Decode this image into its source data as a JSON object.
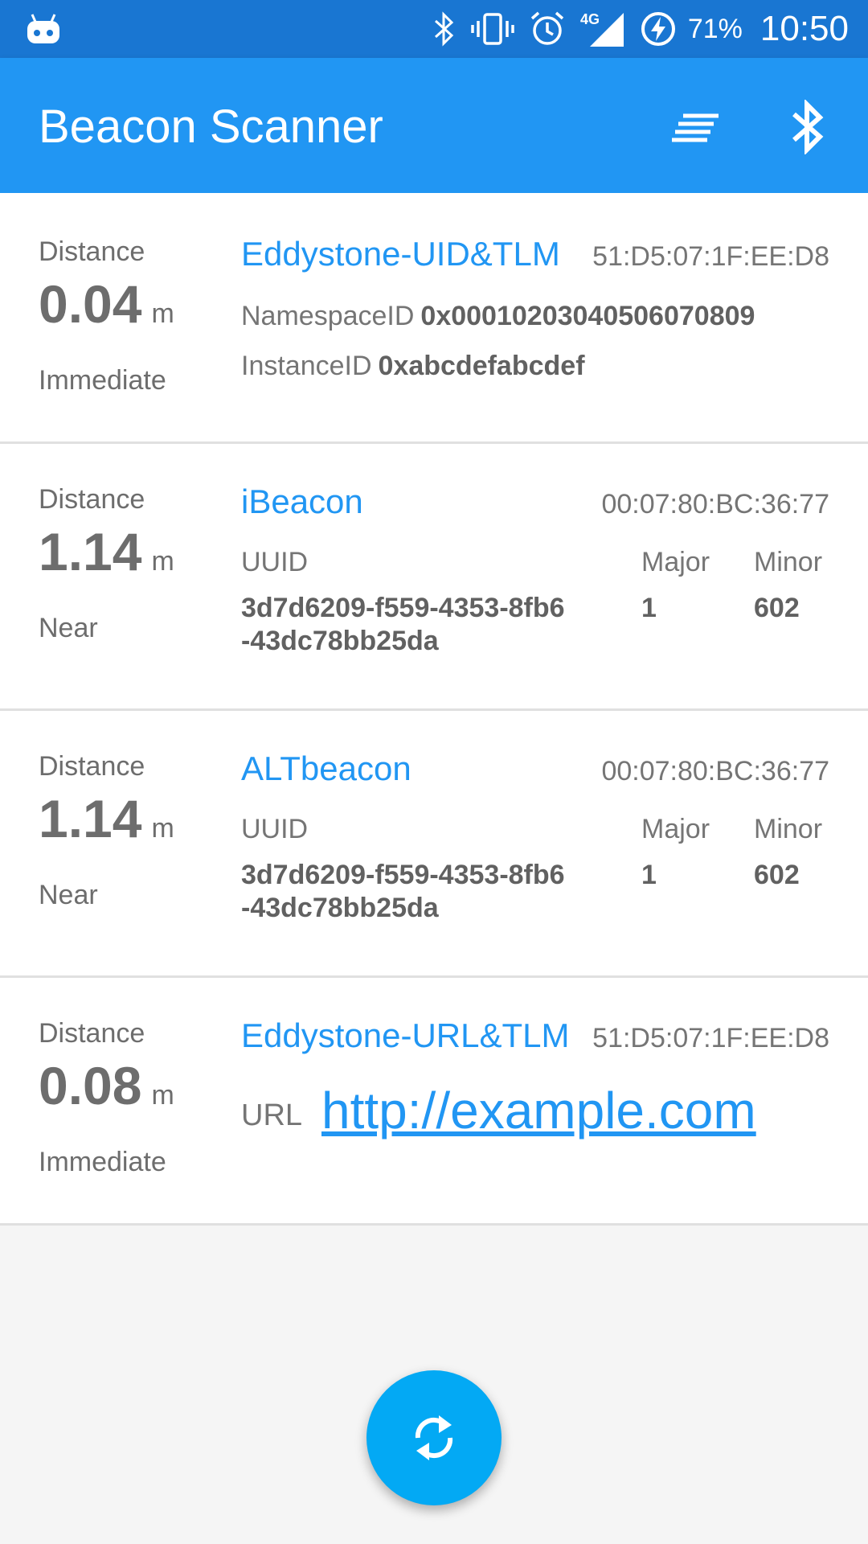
{
  "status_bar": {
    "battery": "71%",
    "time": "10:50",
    "network": "4G",
    "icons": [
      "android-robot-icon",
      "bluetooth-icon",
      "vibrate-icon",
      "alarm-icon",
      "signal-icon",
      "battery-charging-icon"
    ]
  },
  "app_bar": {
    "title": "Beacon Scanner",
    "actions": [
      "sort-icon",
      "bluetooth-icon"
    ]
  },
  "beacons": [
    {
      "distance_label": "Distance",
      "distance_value": "0.04",
      "distance_unit": "m",
      "proximity": "Immediate",
      "type": "Eddystone-UID&TLM",
      "mac": "51:D5:07:1F:EE:D8",
      "namespace_label": "NamespaceID",
      "namespace_value": "0x00010203040506070809",
      "instance_label": "InstanceID",
      "instance_value": "0xabcdefabcdef"
    },
    {
      "distance_label": "Distance",
      "distance_value": "1.14",
      "distance_unit": "m",
      "proximity": "Near",
      "type": "iBeacon",
      "mac": "00:07:80:BC:36:77",
      "uuid_label": "UUID",
      "uuid_line1": "3d7d6209-f559-4353-8fb6",
      "uuid_line2": "-43dc78bb25da",
      "major_label": "Major",
      "major_value": "1",
      "minor_label": "Minor",
      "minor_value": "602"
    },
    {
      "distance_label": "Distance",
      "distance_value": "1.14",
      "distance_unit": "m",
      "proximity": "Near",
      "type": "ALTbeacon",
      "mac": "00:07:80:BC:36:77",
      "uuid_label": "UUID",
      "uuid_line1": "3d7d6209-f559-4353-8fb6",
      "uuid_line2": "-43dc78bb25da",
      "major_label": "Major",
      "major_value": "1",
      "minor_label": "Minor",
      "minor_value": "602"
    },
    {
      "distance_label": "Distance",
      "distance_value": "0.08",
      "distance_unit": "m",
      "proximity": "Immediate",
      "type": "Eddystone-URL&TLM",
      "mac": "51:D5:07:1F:EE:D8",
      "url_label": "URL",
      "url": "http://example.com"
    }
  ],
  "fab": {
    "icon": "refresh-icon"
  },
  "colors": {
    "status_bar": "#1976d2",
    "app_bar": "#2196f3",
    "accent": "#03a9f4",
    "link": "#2196f3"
  }
}
